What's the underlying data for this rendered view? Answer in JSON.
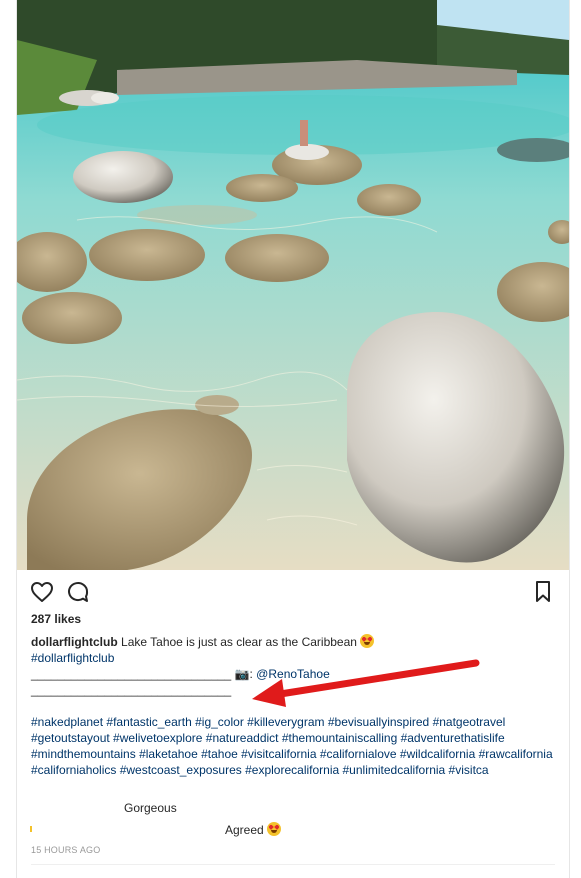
{
  "post": {
    "likes": "287 likes",
    "caption": {
      "username": "dollarflightclub",
      "text": "Lake Tahoe is just as clear as the Caribbean",
      "hashtag_line": "#dollarflightclub",
      "separator_1": "______________________________",
      "camera": "📷: ",
      "credit": "@RenoTahoe",
      "separator_2": "______________________________"
    },
    "hashtags": "#nakedplanet #fantastic_earth #ig_color #killeverygram #bevisuallyinspired #natgeotravel #getoutstayout #welivetoexplore #natureaddict #themountainiscalling #adventurethatislife #mindthemountains #laketahoe #tahoe #visitcalifornia #californialove #wildcalifornia #rawcalifornia #californiaholics #westcoast_exposures #explorecalifornia #unlimitedcalifornia #visitca",
    "comments": [
      {
        "text": "Gorgeous"
      },
      {
        "text": "Agreed"
      }
    ],
    "timestamp": "15 HOURS AGO"
  },
  "icons": {
    "like": "heart-icon",
    "comment": "speech-bubble-icon",
    "save": "bookmark-icon",
    "emoji": "heart-eyes-emoji",
    "annotation": "red-arrow"
  },
  "colors": {
    "link": "#003569",
    "text": "#262626",
    "muted": "#999999",
    "arrow": "#e01b1b"
  }
}
